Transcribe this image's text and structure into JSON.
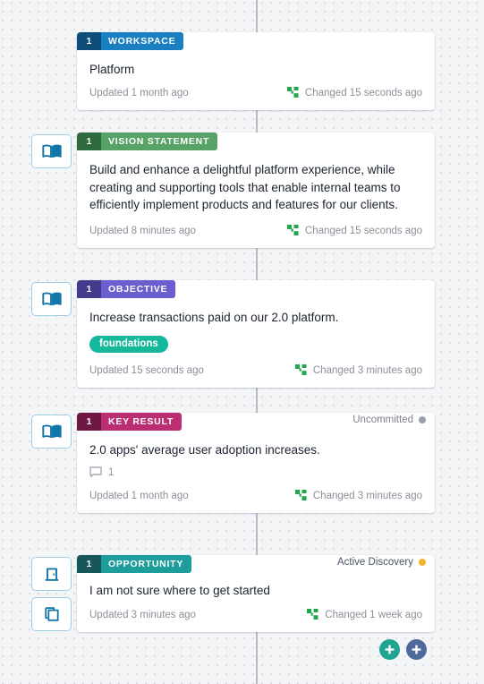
{
  "board": {
    "background": "#f4f5f7",
    "dot_color": "#dcdee3",
    "connector_color": "#b9bcc4"
  },
  "nodes": [
    {
      "id": "workspace",
      "badge_number": "1",
      "type_label": "WORKSPACE",
      "chip_color": "#1a7fc1",
      "chip_num_color": "#0e4d79",
      "title": "Platform",
      "updated": "Updated 1 month ago",
      "changed": "Changed 15 seconds ago",
      "status_label": "",
      "status_color": "",
      "tag": "",
      "comment_count": "",
      "icons": []
    },
    {
      "id": "vision-statement",
      "badge_number": "1",
      "type_label": "VISION STATEMENT",
      "chip_color": "#56a267",
      "chip_num_color": "#2f6b3e",
      "title": "Build and enhance a delightful platform experience, while creating and supporting tools that enable internal teams to efficiently implement products and features for our clients.",
      "updated": "Updated 8 minutes ago",
      "changed": "Changed 15 seconds ago",
      "status_label": "",
      "status_color": "",
      "tag": "",
      "comment_count": "",
      "icons": [
        "book-icon"
      ]
    },
    {
      "id": "objective",
      "badge_number": "1",
      "type_label": "OBJECTIVE",
      "chip_color": "#6b5ece",
      "chip_num_color": "#443a8c",
      "title": "Increase transactions paid on our 2.0 platform.",
      "updated": "Updated 15 seconds ago",
      "changed": "Changed 3 minutes ago",
      "status_label": "",
      "status_color": "",
      "tag": "foundations",
      "tag_color": "#16b89c",
      "comment_count": "",
      "icons": [
        "book-icon"
      ]
    },
    {
      "id": "key-result",
      "badge_number": "1",
      "type_label": "KEY RESULT",
      "chip_color": "#bc2e72",
      "chip_num_color": "#6f1745",
      "title": "2.0 apps' average user adoption increases.",
      "updated": "Updated 1 month ago",
      "changed": "Changed 3 minutes ago",
      "status_label": "Uncommitted",
      "status_color": "#9aa0ac",
      "tag": "",
      "comment_count": "1",
      "icons": [
        "book-icon"
      ]
    },
    {
      "id": "opportunity",
      "badge_number": "1",
      "type_label": "OPPORTUNITY",
      "chip_color": "#1d9e9c",
      "chip_num_color": "#17575a",
      "title": "I am not sure where to get started",
      "updated": "Updated 3 minutes ago",
      "changed": "Changed 1 week ago",
      "status_label": "Active Discovery",
      "status_color": "#f0b429",
      "tag": "",
      "comment_count": "",
      "icons": [
        "door-icon",
        "copy-icon"
      ]
    }
  ],
  "changed_icon_name": "green-flow-icon",
  "changed_icon_color": "#22a84b",
  "add_buttons": [
    {
      "name": "add-node-teal-button",
      "color": "#1fa393",
      "icon": "plus-icon"
    },
    {
      "name": "add-node-blue-button",
      "color": "#4d6a9a",
      "icon": "plus-icon"
    }
  ]
}
